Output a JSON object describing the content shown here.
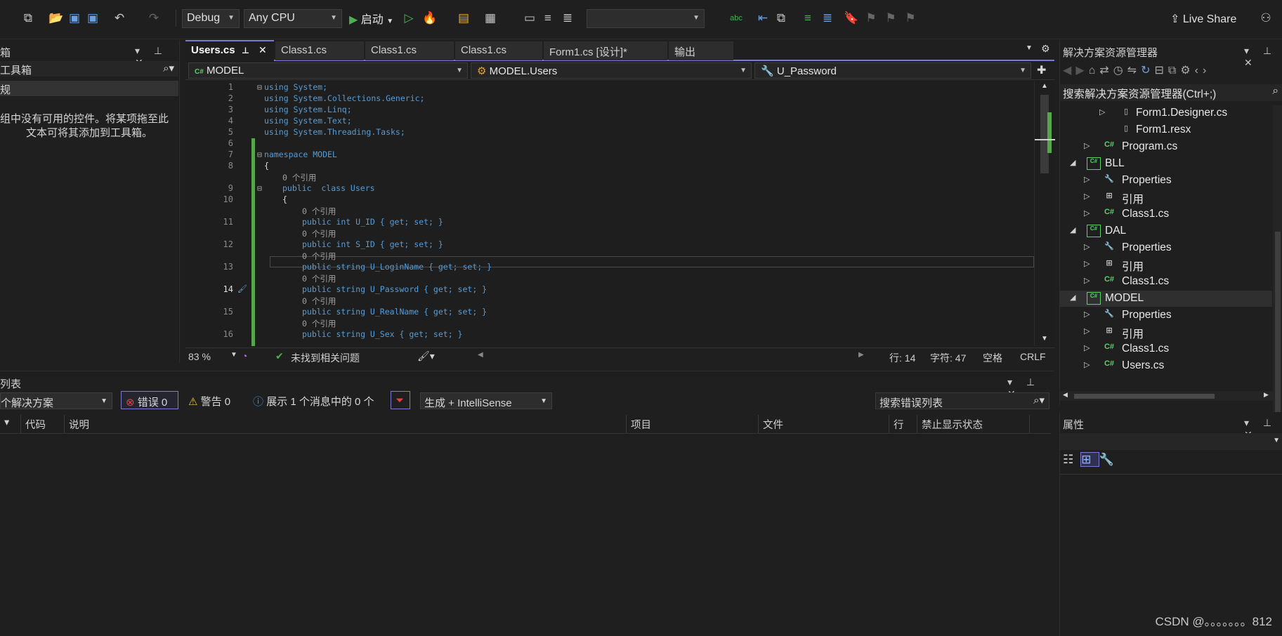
{
  "toolbar": {
    "config": "Debug",
    "platform": "Any CPU",
    "start_label": "启动",
    "live_share": "Live Share"
  },
  "toolbox": {
    "title": "箱",
    "search_label": "工具箱",
    "section": "规",
    "empty_message_line1": "组中没有可用的控件。将某项拖至此",
    "empty_message_line2": "文本可将其添加到工具箱。"
  },
  "editor": {
    "tabs": [
      {
        "label": "Users.cs",
        "active": true
      },
      {
        "label": "Class1.cs",
        "active": false
      },
      {
        "label": "Class1.cs",
        "active": false
      },
      {
        "label": "Class1.cs",
        "active": false
      },
      {
        "label": "Form1.cs [设计]*",
        "active": false
      },
      {
        "label": "输出",
        "active": false
      }
    ],
    "nav": {
      "project": "MODEL",
      "type": "MODEL.Users",
      "member": "U_Password"
    },
    "ref_hint": "0 个引用",
    "lines": [
      {
        "n": "1",
        "text": "using System;"
      },
      {
        "n": "2",
        "text": "using System.Collections.Generic;"
      },
      {
        "n": "3",
        "text": "using System.Linq;"
      },
      {
        "n": "4",
        "text": "using System.Text;"
      },
      {
        "n": "5",
        "text": "using System.Threading.Tasks;"
      },
      {
        "n": "6",
        "text": ""
      },
      {
        "n": "7",
        "text": "namespace MODEL"
      },
      {
        "n": "8",
        "text": "{"
      },
      {
        "n": "9",
        "text": "public  class Users"
      },
      {
        "n": "10",
        "text": "{"
      },
      {
        "n": "11",
        "text": "public int U_ID { get; set; }"
      },
      {
        "n": "12",
        "text": "public int S_ID { get; set; }"
      },
      {
        "n": "13",
        "text": "public string U_LoginName { get; set; }"
      },
      {
        "n": "14",
        "text": "public string U_Password { get; set; }"
      },
      {
        "n": "15",
        "text": "public string U_RealName { get; set; }"
      },
      {
        "n": "16",
        "text": "public string U_Sex { get; set; }"
      }
    ],
    "status": {
      "zoom": "83 %",
      "issues": "未找到相关问题",
      "line": "行: 14",
      "char": "字符: 47",
      "whitespace": "空格",
      "eol": "CRLF"
    }
  },
  "solution_explorer": {
    "title": "解决方案资源管理器",
    "search": "搜索解决方案资源管理器(Ctrl+;)",
    "items": [
      {
        "label": "Form1.Designer.cs",
        "icon": "file-icon"
      },
      {
        "label": "Form1.resx",
        "icon": "file-icon"
      },
      {
        "label": "Program.cs",
        "icon": "csharp-file-icon"
      },
      {
        "label": "BLL",
        "icon": "project-icon"
      },
      {
        "label": "Properties",
        "icon": "wrench-icon"
      },
      {
        "label": "引用",
        "icon": "references-icon"
      },
      {
        "label": "Class1.cs",
        "icon": "csharp-file-icon"
      },
      {
        "label": "DAL",
        "icon": "project-icon"
      },
      {
        "label": "Properties",
        "icon": "wrench-icon"
      },
      {
        "label": "引用",
        "icon": "references-icon"
      },
      {
        "label": "Class1.cs",
        "icon": "csharp-file-icon"
      },
      {
        "label": "MODEL",
        "icon": "project-icon"
      },
      {
        "label": "Properties",
        "icon": "wrench-icon"
      },
      {
        "label": "引用",
        "icon": "references-icon"
      },
      {
        "label": "Class1.cs",
        "icon": "csharp-file-icon"
      },
      {
        "label": "Users.cs",
        "icon": "csharp-file-icon"
      }
    ]
  },
  "properties": {
    "title": "属性"
  },
  "error_list": {
    "title": "列表",
    "scope": "个解决方案",
    "errors": "错误 0",
    "warnings": "警告 0",
    "messages": "展示 1 个消息中的 0 个",
    "source": "生成 + IntelliSense",
    "search": "搜索错误列表",
    "columns": [
      "代码",
      "说明",
      "项目",
      "文件",
      "行",
      "禁止显示状态"
    ]
  },
  "watermark": "CSDN @。。。。。。。812",
  "colors": {
    "accent": "#7b7bd6",
    "keyword": "#569cd6",
    "type": "#4ec9b0",
    "csharp_icon": "#5fd068",
    "error_red": "#e0443e",
    "warning_yellow": "#e8c33a",
    "info_blue": "#3c8fe0"
  }
}
